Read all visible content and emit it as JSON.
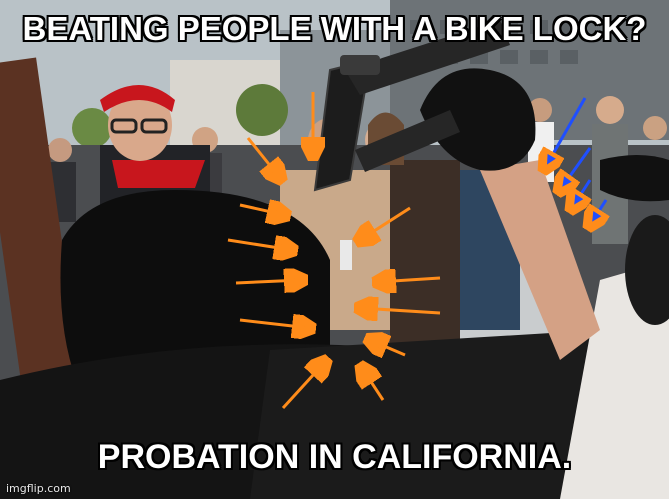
{
  "meme": {
    "top_caption": "BEATING PEOPLE WITH A BIKE LOCK?",
    "bottom_caption": "PROBATION IN CALIFORNIA.",
    "watermark": "imgflip.com"
  },
  "colors": {
    "orange_arrows": "#ff8c1a",
    "blue_arrows": "#1f4fff",
    "bandana": "#c8161d",
    "hood": "#0d0d0d"
  }
}
